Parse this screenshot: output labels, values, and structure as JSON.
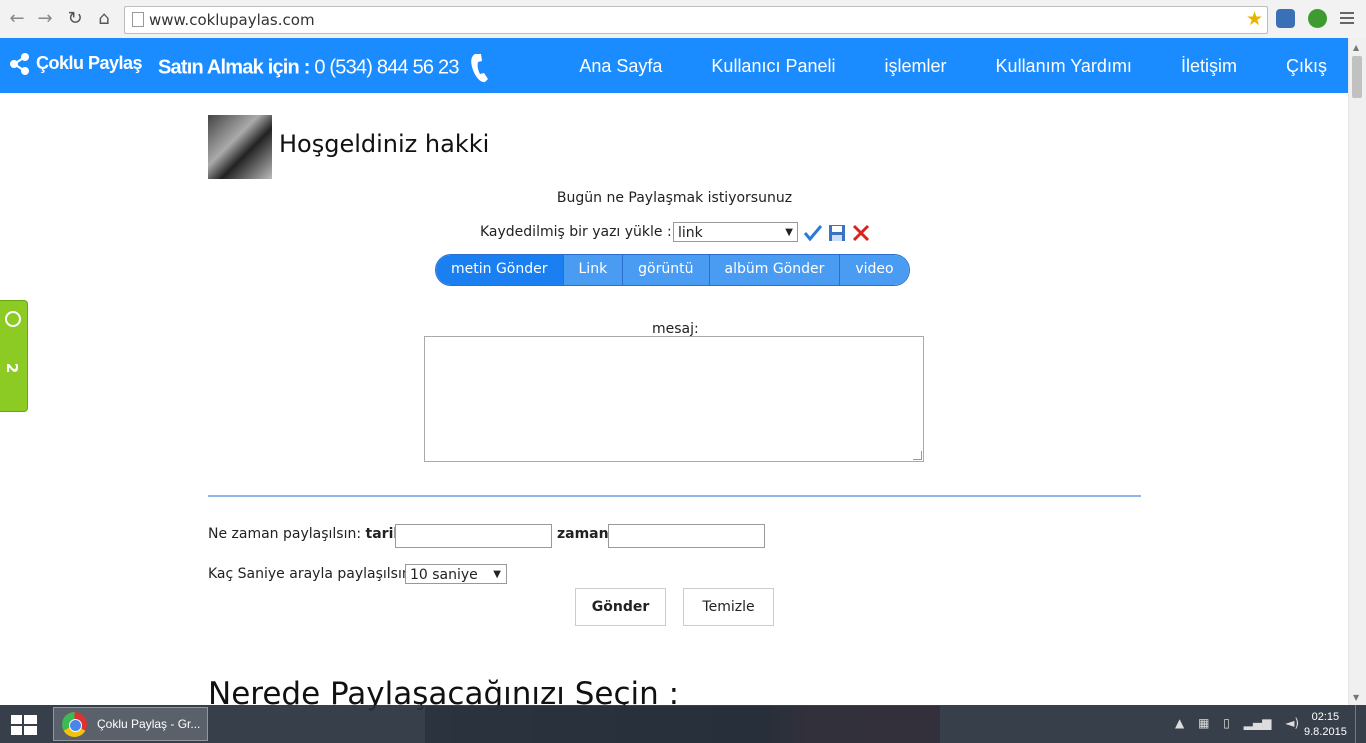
{
  "browser": {
    "url": "www.coklupaylas.com"
  },
  "site": {
    "brand": "Çoklu Paylaş",
    "phone_prefix": "Satın Almak için :",
    "phone_number": "0 (534) 844 56 23",
    "menu": [
      "Ana Sayfa",
      "Kullanıcı Paneli",
      "işlemler",
      "Kullanım Yardımı",
      "İletişim",
      "Çıkış"
    ],
    "accent_color": "#1a8cff"
  },
  "side_widget": {
    "count": "2"
  },
  "main": {
    "welcome": "Hoşgeldiniz hakki",
    "prompt": "Bugün ne Paylaşmak istiyorsunuz",
    "load_label": "Kaydedilmiş bir yazı yükle :",
    "load_select": "link",
    "tabs": [
      "metin Gönder",
      "Link",
      "görüntü",
      "albüm Gönder",
      "video"
    ],
    "active_tab": "metin Gönder",
    "message_label": "mesaj:",
    "message_value": "",
    "when_label": "Ne zaman paylaşılsın:",
    "date_label": "tarih",
    "time_label": "zaman",
    "date_value": "",
    "time_value": "",
    "interval_label": "Kaç Saniye arayla paylaşılsın:",
    "interval_select": "10 saniye",
    "submit_label": "Gönder",
    "clear_label": "Temizle",
    "section_heading": "Nerede Paylaşacağınızı Seçin :"
  },
  "taskbar": {
    "task_label": "Çoklu Paylaş - Gr...",
    "time": "02:15",
    "date": "9.8.2015"
  }
}
